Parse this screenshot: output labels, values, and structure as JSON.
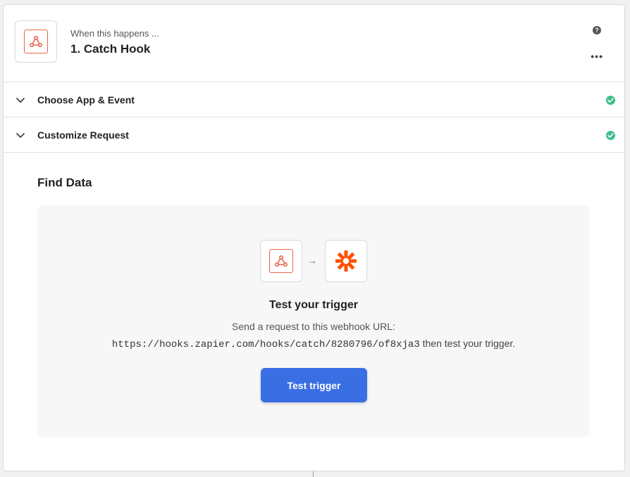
{
  "step": {
    "subtitle": "When this happens ...",
    "title": "1. Catch Hook",
    "help_glyph": "?",
    "more_glyph": "•••",
    "app_icon": "webhook-icon"
  },
  "sections": [
    {
      "label": "Choose App & Event",
      "status": "complete",
      "status_color": "#3dbf8a"
    },
    {
      "label": "Customize Request",
      "status": "complete",
      "status_color": "#3dbf8a"
    }
  ],
  "find_data": {
    "title": "Find Data",
    "arrow": "→",
    "test_title": "Test your trigger",
    "description": "Send a request to this webhook URL:",
    "webhook_url": "https://hooks.zapier.com/hooks/catch/8280796/of8xja3",
    "url_suffix": " then test your trigger.",
    "button_label": "Test trigger"
  },
  "colors": {
    "accent": "#3a6fe4",
    "webhook": "#e8644a",
    "zapier": "#ff4f00",
    "success": "#3dbf8a"
  }
}
